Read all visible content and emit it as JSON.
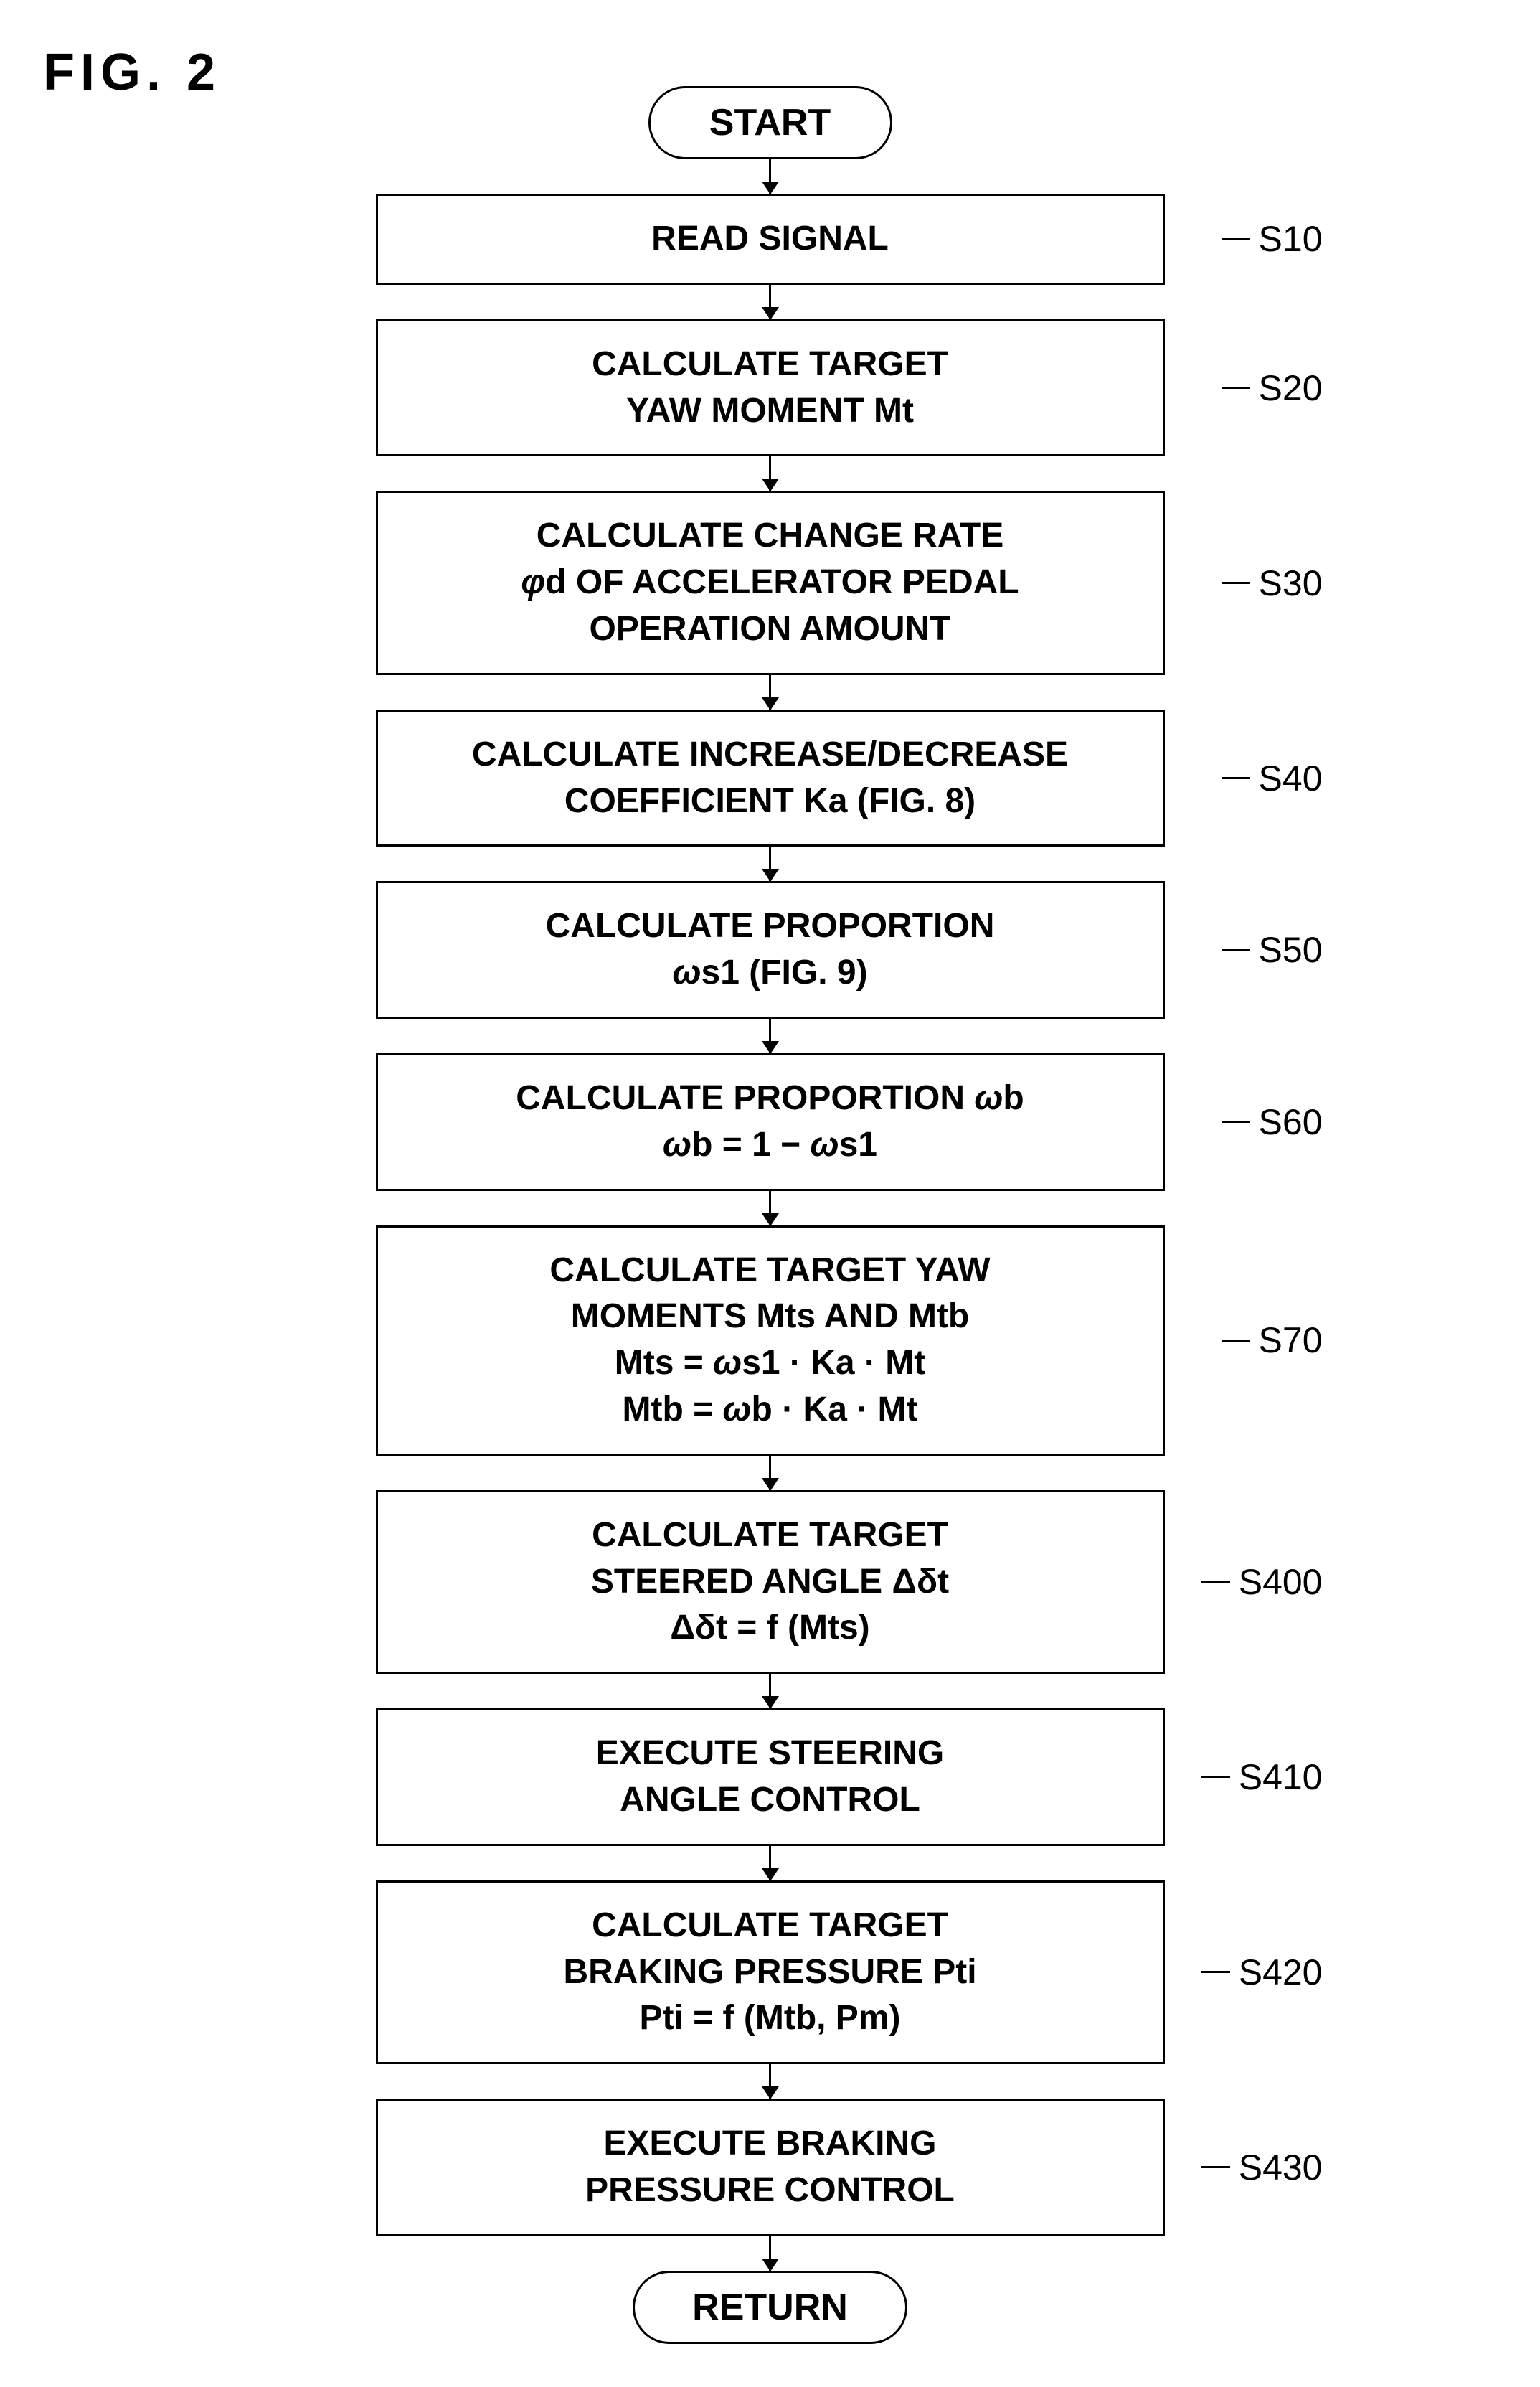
{
  "fig_label": "FIG. 2",
  "nodes": [
    {
      "id": "start",
      "type": "capsule",
      "text": "START",
      "step": null
    },
    {
      "id": "s10",
      "type": "process",
      "text": "READ SIGNAL",
      "step": "S10"
    },
    {
      "id": "s20",
      "type": "process",
      "text": "CALCULATE TARGET\nYAW MOMENT Mt",
      "step": "S20"
    },
    {
      "id": "s30",
      "type": "process",
      "text": "CALCULATE CHANGE RATE\nφd OF ACCELERATOR PEDAL\nOPERATION AMOUNT",
      "step": "S30"
    },
    {
      "id": "s40",
      "type": "process",
      "text": "CALCULATE INCREASE/DECREASE\nCOEFFICIENT Ka (FIG. 8)",
      "step": "S40"
    },
    {
      "id": "s50",
      "type": "process",
      "text": "CALCULATE PROPORTION\nωs1 (FIG. 9)",
      "step": "S50"
    },
    {
      "id": "s60",
      "type": "process",
      "text": "CALCULATE PROPORTION ωb\nωb = 1 − ωs1",
      "step": "S60"
    },
    {
      "id": "s70",
      "type": "process",
      "text": "CALCULATE TARGET YAW\nMOMENTS Mts AND Mtb\nMts = ωs1 · Ka · Mt\nMtb = ωb · Ka · Mt",
      "step": "S70"
    },
    {
      "id": "s400",
      "type": "process",
      "text": "CALCULATE TARGET\nSTEERED ANGLE Δδt\nΔδt = f (Mts)",
      "step": "S400"
    },
    {
      "id": "s410",
      "type": "process",
      "text": "EXECUTE STEERING\nANGLE CONTROL",
      "step": "S410"
    },
    {
      "id": "s420",
      "type": "process",
      "text": "CALCULATE TARGET\nBRAKING PRESSURE Pti\nPti = f (Mtb, Pm)",
      "step": "S420"
    },
    {
      "id": "s430",
      "type": "process",
      "text": "EXECUTE BRAKING\nPRESSURE CONTROL",
      "step": "S430"
    },
    {
      "id": "return",
      "type": "capsule",
      "text": "RETURN",
      "step": null
    }
  ]
}
